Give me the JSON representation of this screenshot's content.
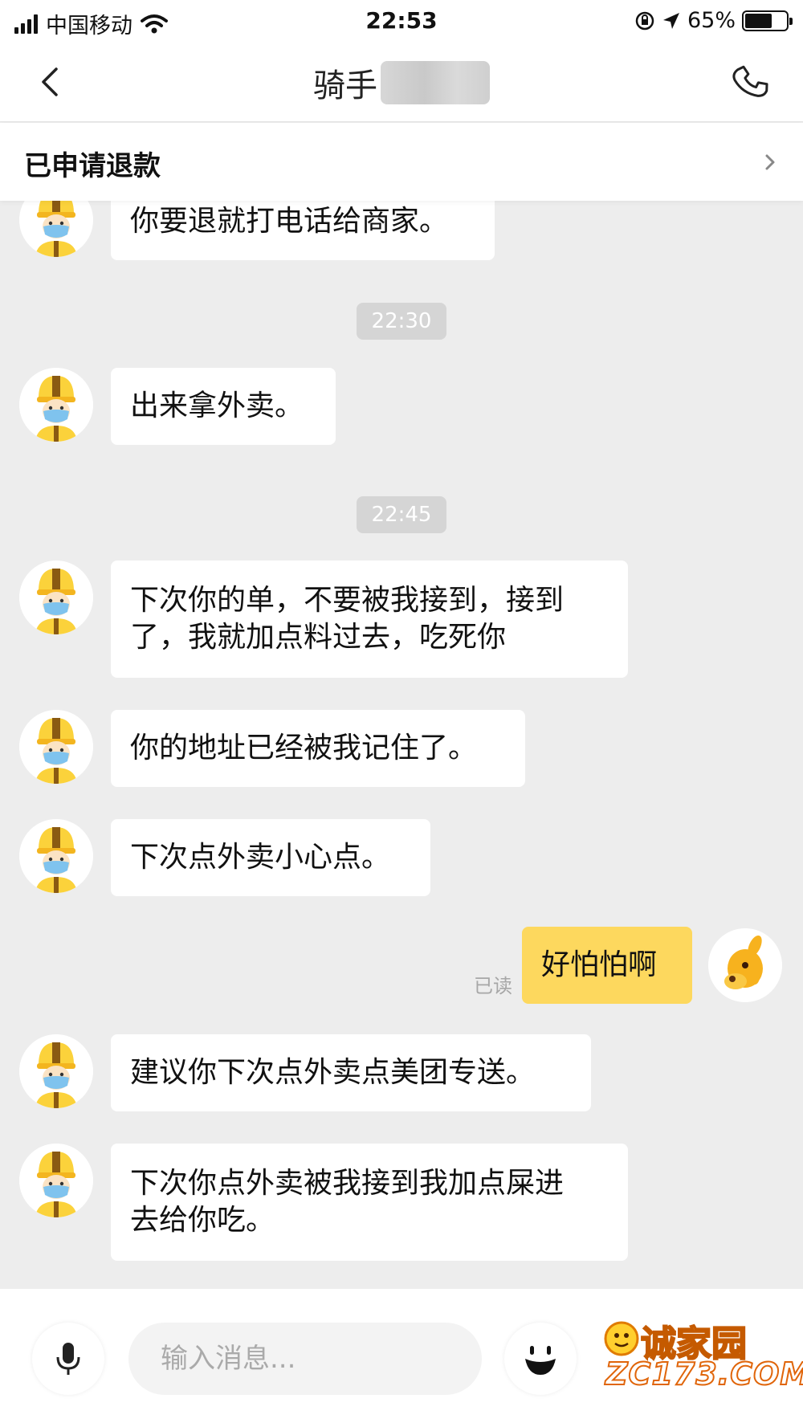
{
  "status_bar": {
    "carrier": "中国移动",
    "time": "22:53",
    "battery_percent": "65%",
    "battery_level": 0.65
  },
  "nav": {
    "title": "骑手",
    "back_icon": "chevron-left-icon",
    "call_icon": "phone-icon"
  },
  "refund_banner": {
    "label": "已申请退款"
  },
  "messages": [
    {
      "kind": "rider",
      "text": "你要退就打电话给商家。"
    },
    {
      "kind": "time",
      "text": "22:30"
    },
    {
      "kind": "rider",
      "text": "出来拿外卖。"
    },
    {
      "kind": "time",
      "text": "22:45"
    },
    {
      "kind": "rider",
      "lines": [
        "下次你的单，不要被我接到，接到",
        "了，我就加点料过去，吃死你"
      ]
    },
    {
      "kind": "rider",
      "text": "你的地址已经被我记住了。"
    },
    {
      "kind": "rider",
      "text": "下次点外卖小心点。"
    },
    {
      "kind": "self",
      "text": "好怕怕啊",
      "status": "已读"
    },
    {
      "kind": "rider",
      "text": "建议你下次点外卖点美团专送。"
    },
    {
      "kind": "rider",
      "lines": [
        "下次你点外卖被我接到我加点屎进",
        "去给你吃。"
      ]
    }
  ],
  "input_bar": {
    "placeholder": "输入消息...",
    "voice_icon": "microphone-icon",
    "emoji_icon": "emoji-icon"
  },
  "watermark": {
    "brand": "诚家园",
    "url": "ZC173.COM"
  },
  "colors": {
    "self_bubble": "#fdd85e",
    "chat_background": "#ededed",
    "rider_bubble": "#ffffff"
  }
}
